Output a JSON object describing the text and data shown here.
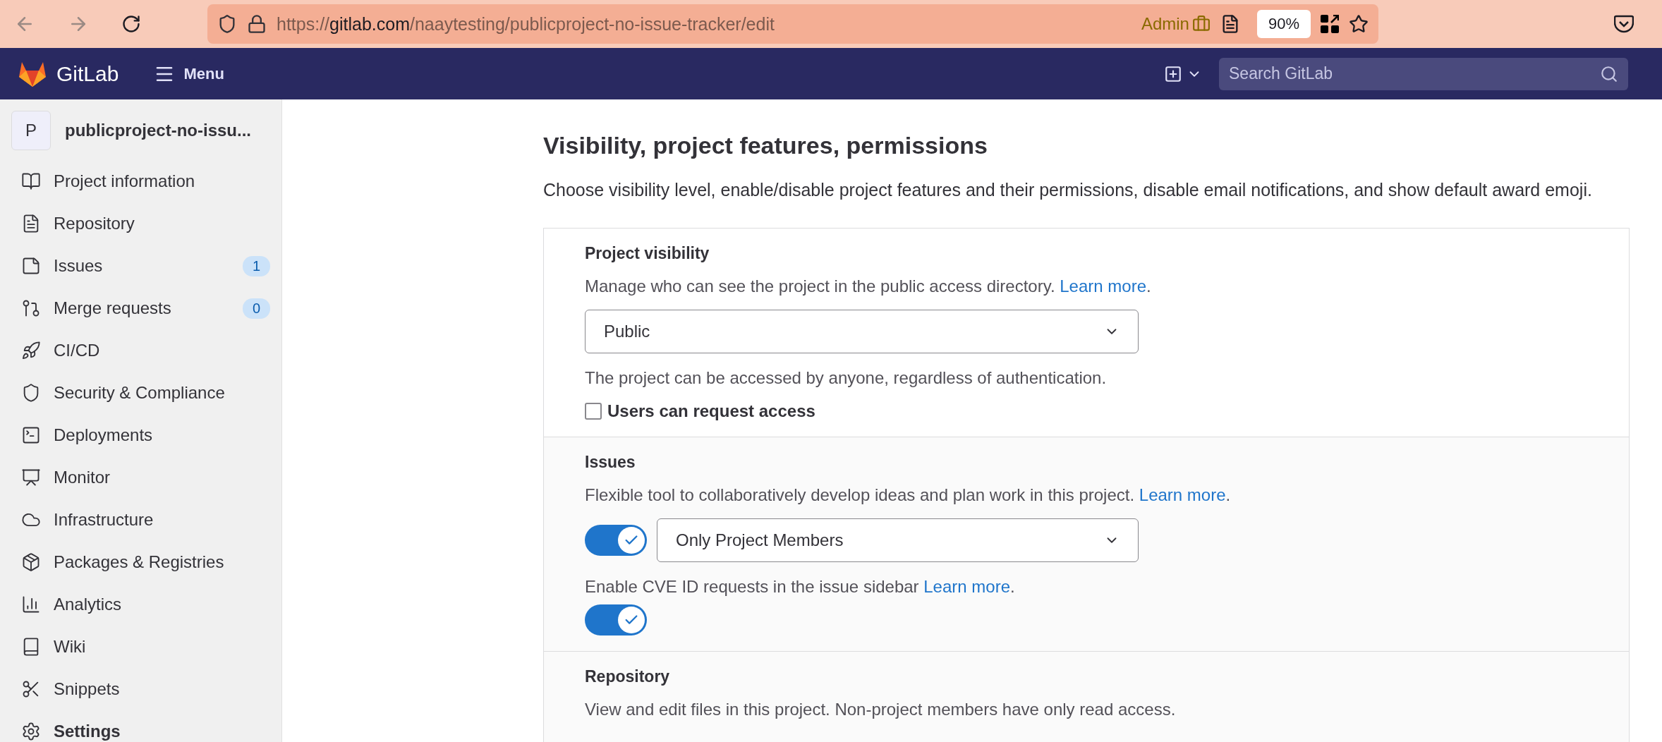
{
  "browser": {
    "url_parts": [
      "https://",
      "gitlab.com",
      "/naaytesting/publicproject-no-issue-tracker/edit"
    ],
    "admin_badge": "Admin",
    "zoom": "90%"
  },
  "header": {
    "brand": "GitLab",
    "menu": "Menu",
    "search": {
      "placeholder": "Search GitLab"
    }
  },
  "sidebar": {
    "project": {
      "avatar": "P",
      "name": "publicproject-no-issu..."
    },
    "items": [
      {
        "label": "Project information",
        "selected": false
      },
      {
        "label": "Repository",
        "selected": false
      },
      {
        "label": "Issues",
        "count": "1",
        "selected": false
      },
      {
        "label": "Merge requests",
        "count": "0",
        "selected": false
      },
      {
        "label": "CI/CD",
        "selected": false
      },
      {
        "label": "Security & Compliance",
        "selected": false
      },
      {
        "label": "Deployments",
        "selected": false
      },
      {
        "label": "Monitor",
        "selected": false
      },
      {
        "label": "Infrastructure",
        "selected": false
      },
      {
        "label": "Packages & Registries",
        "selected": false
      },
      {
        "label": "Analytics",
        "selected": false
      },
      {
        "label": "Wiki",
        "selected": false
      },
      {
        "label": "Snippets",
        "selected": false
      },
      {
        "label": "Settings",
        "selected": true
      }
    ]
  },
  "page": {
    "title": "Visibility, project features, permissions",
    "description": "Choose visibility level, enable/disable project features and their permissions, disable email notifications, and show default award emoji.",
    "sections": [
      {
        "title": "Project visibility",
        "help": "Manage who can see the project in the public access directory.",
        "link": "Learn more",
        "link_end": ".",
        "select": "Public",
        "note": "The project can be accessed by anyone, regardless of authentication.",
        "checkbox": {
          "label": "Users can request access",
          "checked": false
        }
      },
      {
        "title": "Issues",
        "help": "Flexible tool to collaboratively develop ideas and plan work in this project.",
        "link": "Learn more",
        "link_end": ".",
        "toggle": {
          "on": true
        },
        "select": "Only Project Members",
        "sub": {
          "help": "Enable CVE ID requests in the issue sidebar",
          "link": "Learn more",
          "link_end": ".",
          "toggle": {
            "on": true
          }
        }
      },
      {
        "title": "Repository",
        "help": "View and edit files in this project. Non-project members have only read access."
      }
    ]
  }
}
